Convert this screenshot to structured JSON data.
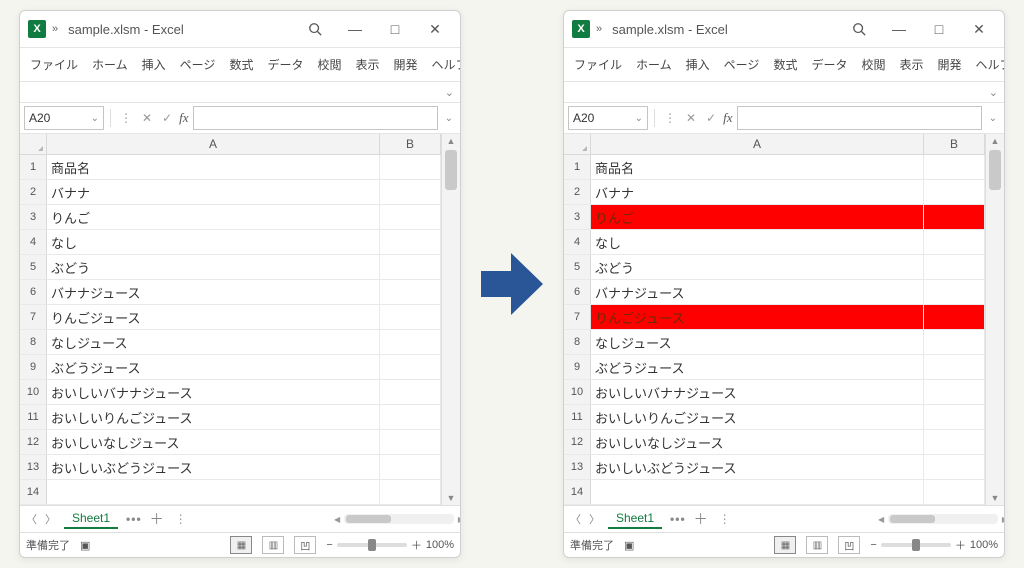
{
  "title": "sample.xlsm  -  Excel",
  "ribbon": [
    "ファイル",
    "ホーム",
    "挿入",
    "ページ",
    "数式",
    "データ",
    "校閲",
    "表示",
    "開発",
    "ヘルプ"
  ],
  "namebox": "A20",
  "fx_label": "fx",
  "sheet_name": "Sheet1",
  "status_text": "準備完了",
  "zoom_pct": "100%",
  "col_headers": [
    "A",
    "B"
  ],
  "rows": [
    {
      "n": "1",
      "a": "商品名"
    },
    {
      "n": "2",
      "a": "バナナ"
    },
    {
      "n": "3",
      "a": "りんご",
      "hl": true
    },
    {
      "n": "4",
      "a": "なし"
    },
    {
      "n": "5",
      "a": "ぶどう"
    },
    {
      "n": "6",
      "a": "バナナジュース"
    },
    {
      "n": "7",
      "a": "りんごジュース",
      "hl": true
    },
    {
      "n": "8",
      "a": "なしジュース"
    },
    {
      "n": "9",
      "a": "ぶどうジュース"
    },
    {
      "n": "10",
      "a": "おいしいバナナジュース"
    },
    {
      "n": "11",
      "a": "おいしいりんごジュース"
    },
    {
      "n": "12",
      "a": "おいしいなしジュース"
    },
    {
      "n": "13",
      "a": "おいしいぶどうジュース"
    },
    {
      "n": "14",
      "a": ""
    }
  ],
  "icons": {
    "minimize": "—",
    "maximize": "□",
    "close": "✕",
    "search": "🔍",
    "chev": "»",
    "dropdown": "⌄",
    "cancel": "✕",
    "check": "✓",
    "dots": "⋮",
    "more": "•••",
    "plus": "＋",
    "nav_l": "〈",
    "nav_r": "〉",
    "rec": "▣",
    "grid": "▦",
    "page": "▥",
    "break": "凹",
    "minus": "−",
    "plus2": "＋"
  }
}
